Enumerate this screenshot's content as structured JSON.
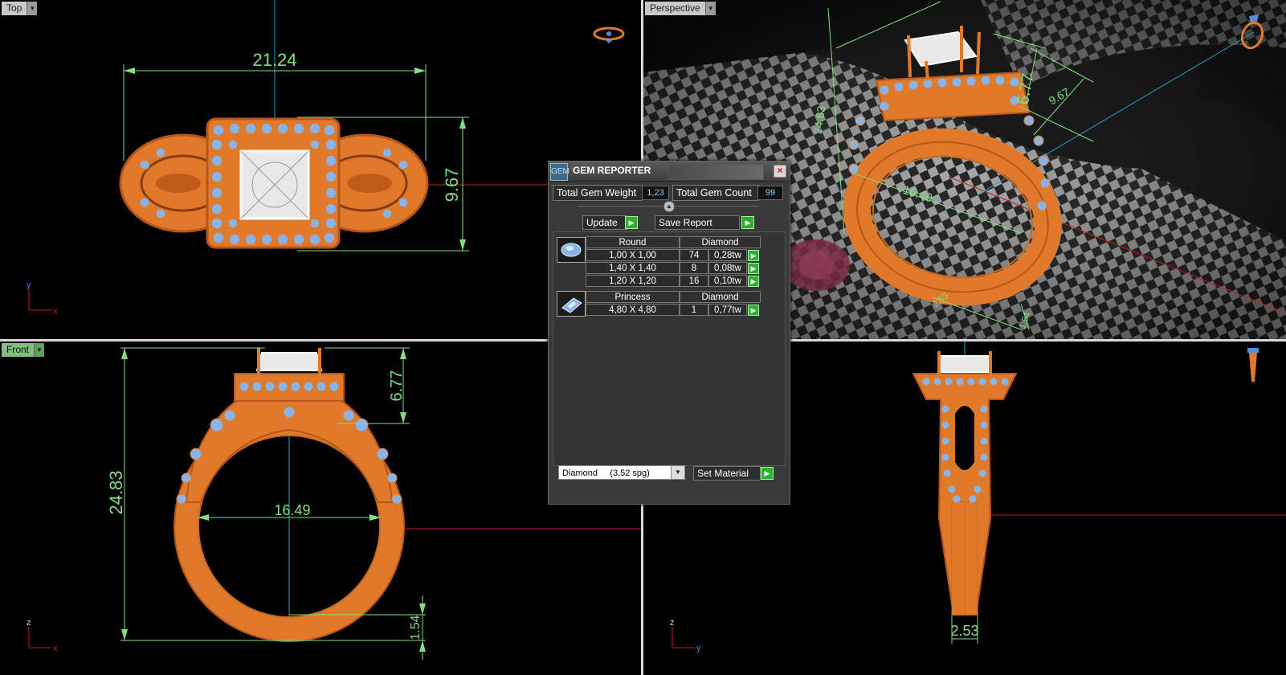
{
  "viewports": {
    "top": {
      "label": "Top",
      "dim_width": "21.24",
      "dim_height": "9.67",
      "axis_x": "x",
      "axis_y": "y"
    },
    "perspective": {
      "label": "Perspective",
      "dim_height": "6.77",
      "dim_length": "9.67",
      "dim_side": "24.83",
      "dim_inner": "16.49",
      "dim_shank": "2.53",
      "dim_base": "1.54"
    },
    "front": {
      "label": "Front",
      "dim_total": "24.83",
      "dim_head": "6.77",
      "dim_inner": "16.49",
      "dim_base": "1.54",
      "axis_x": "x",
      "axis_z": "z"
    },
    "right": {
      "dim_shank": "2.53",
      "axis_y": "y",
      "axis_z": "z"
    }
  },
  "gem_reporter": {
    "title": "GEM REPORTER",
    "logo": "GEM",
    "close_icon": "×",
    "total_weight_label": "Total Gem Weight",
    "total_weight_value": "1,23",
    "total_count_label": "Total Gem Count",
    "total_count_value": "99",
    "collapse_icon": "▲",
    "update_label": "Update",
    "save_report_label": "Save Report",
    "go_icon": "▶",
    "groups": [
      {
        "shape": "Round",
        "material": "Diamond",
        "icon": "round-gem-icon",
        "rows": [
          {
            "size": "1,00 X 1,00",
            "count": "74",
            "weight": "0,28tw"
          },
          {
            "size": "1,40 X 1,40",
            "count": "8",
            "weight": "0,08tw"
          },
          {
            "size": "1,20 X 1,20",
            "count": "16",
            "weight": "0,10tw"
          }
        ]
      },
      {
        "shape": "Princess",
        "material": "Diamond",
        "icon": "princess-gem-icon",
        "rows": [
          {
            "size": "4,80 X 4,80",
            "count": "1",
            "weight": "0,77tw"
          }
        ]
      }
    ],
    "material_select": "Diamond     (3,52 spg)",
    "set_material_label": "Set Material",
    "dropdown_icon": "▼"
  },
  "colors": {
    "gold": "#e07a2a",
    "gold_dark": "#b8561a",
    "gem_blue": "#8ab4e8",
    "dimension": "#80e080",
    "axis_red": "#c02020",
    "axis_cyan": "#20a0c0"
  }
}
